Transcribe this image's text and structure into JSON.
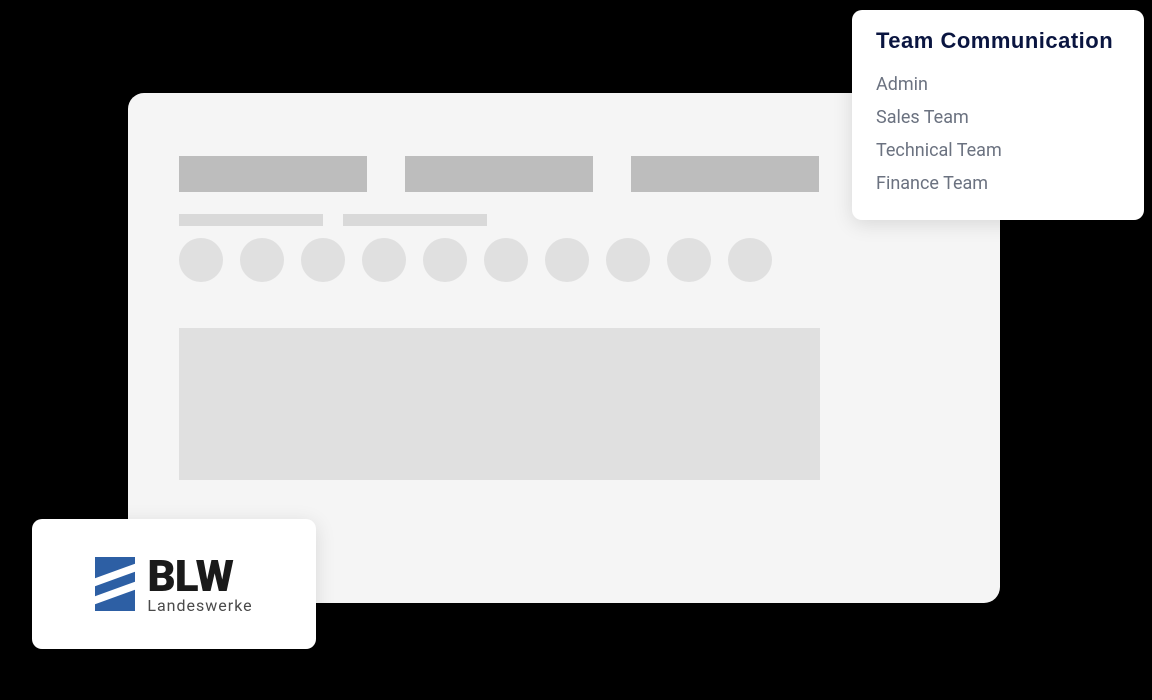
{
  "menu": {
    "title": "Team Communication",
    "items": [
      {
        "label": "Admin"
      },
      {
        "label": "Sales Team"
      },
      {
        "label": "Technical Team"
      },
      {
        "label": "Finance Team"
      }
    ]
  },
  "logo": {
    "main": "BLW",
    "sub": "Landeswerke"
  },
  "skeleton": {
    "topButtonCount": 3,
    "textLineCount": 2,
    "avatarCount": 10
  }
}
